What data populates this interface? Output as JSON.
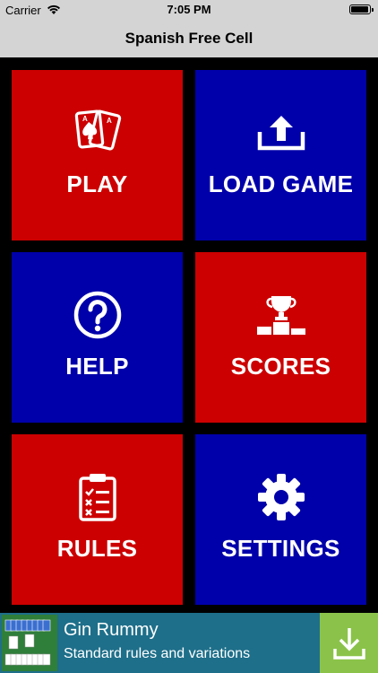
{
  "status_bar": {
    "carrier": "Carrier",
    "time": "7:05 PM"
  },
  "header": {
    "title": "Spanish Free Cell"
  },
  "menu": {
    "play": {
      "label": "PLAY",
      "icon": "playing-cards-icon"
    },
    "load_game": {
      "label": "LOAD GAME",
      "icon": "upload-icon"
    },
    "help": {
      "label": "HELP",
      "icon": "question-circle-icon"
    },
    "scores": {
      "label": "SCORES",
      "icon": "podium-trophy-icon"
    },
    "rules": {
      "label": "RULES",
      "icon": "clipboard-checklist-icon"
    },
    "settings": {
      "label": "SETTINGS",
      "icon": "gear-icon"
    }
  },
  "colors": {
    "red": "#cc0000",
    "blue": "#0000aa",
    "header_bg": "#d4d4d4",
    "ad_bg": "#1e6f8a",
    "ad_download": "#8bc34a"
  },
  "ad_banner": {
    "title": "Gin Rummy",
    "subtitle": "Standard rules and variations",
    "icon": "download-icon"
  }
}
